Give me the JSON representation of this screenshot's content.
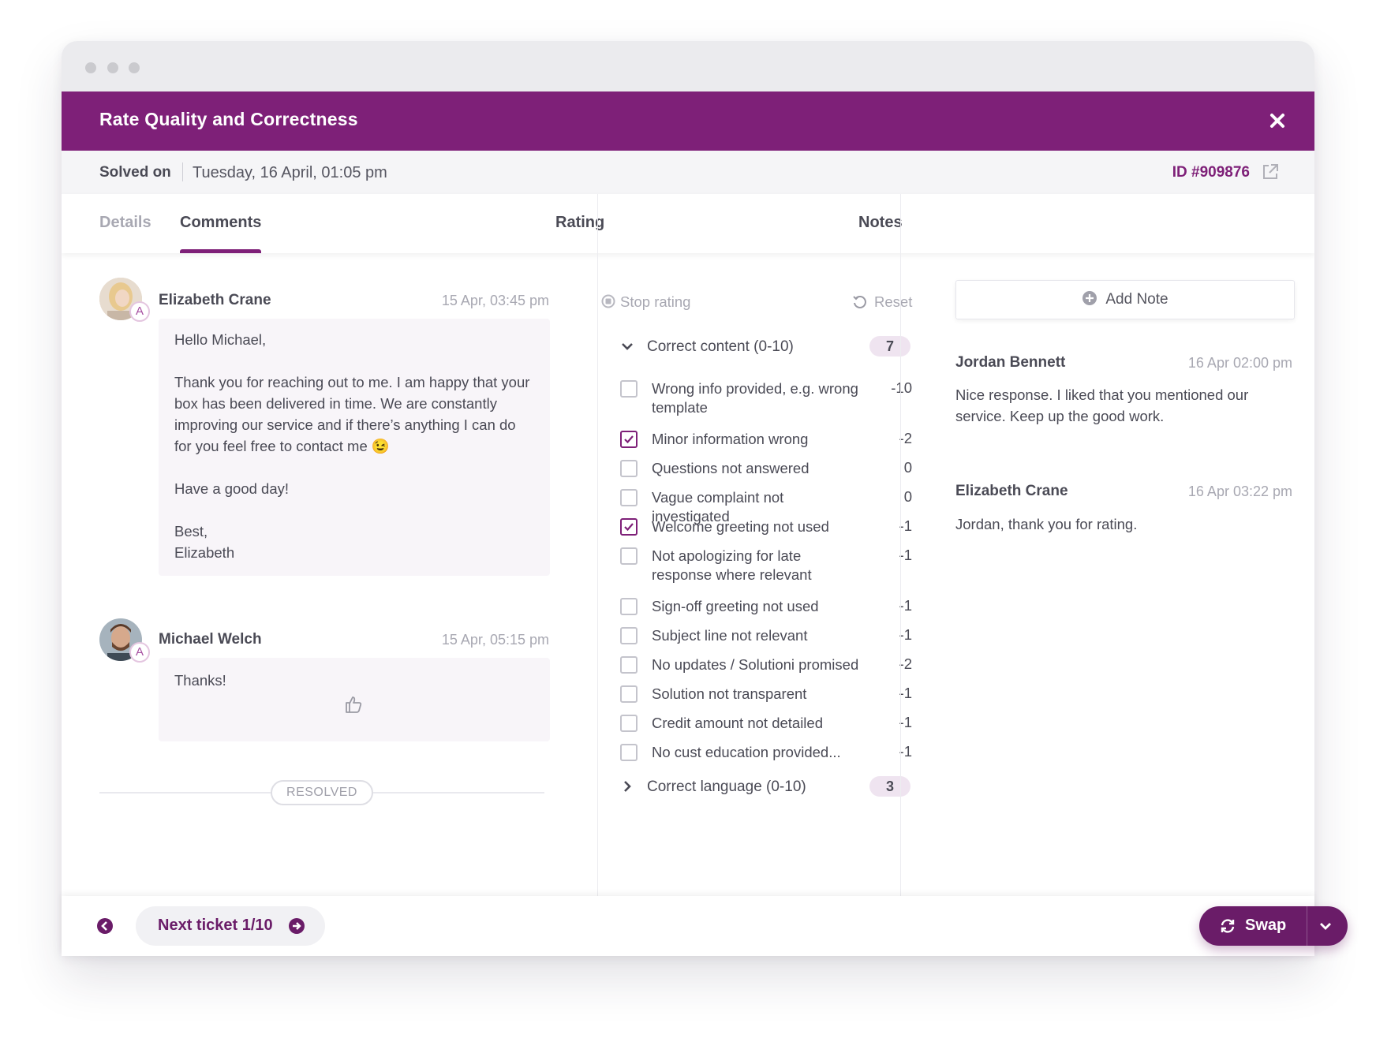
{
  "window": {
    "title": "Rate Quality and Correctness"
  },
  "info": {
    "solved_label": "Solved on",
    "solved_value": "Tuesday, 16 April, 01:05 pm",
    "ticket_id": "ID #909876"
  },
  "tabs": [
    {
      "label": "Details"
    },
    {
      "label": "Comments"
    }
  ],
  "columns": {
    "rating": "Rating",
    "notes": "Notes"
  },
  "comments": [
    {
      "author": "Elizabeth Crane",
      "time": "15 Apr, 03:45 pm",
      "badge": "A",
      "paragraphs": [
        "Hello Michael,",
        "Thank you for reaching out to me. I am happy that your box has been delivered in time. We are constantly improving our service and if there’s anything I can do for you feel free to contact me 😉",
        "Have a good day!",
        "Best,\nElizabeth"
      ]
    },
    {
      "author": "Michael Welch",
      "time": "15 Apr, 05:15 pm",
      "badge": "A",
      "paragraphs": [
        "Thanks!"
      ]
    }
  ],
  "resolved_label": "RESOLVED",
  "rating": {
    "stop_label": "Stop rating",
    "reset_label": "Reset",
    "sections": [
      {
        "label": "Correct content (0-10)",
        "score": "7",
        "expanded": true,
        "items": [
          {
            "label": "Wrong info provided, e.g. wrong template",
            "value": "-10",
            "checked": false
          },
          {
            "label": "Minor information wrong",
            "value": "-2",
            "checked": true
          },
          {
            "label": "Questions not answered",
            "value": "0",
            "checked": false
          },
          {
            "label": "Vague complaint not investigated",
            "value": "0",
            "checked": false
          },
          {
            "label": "Welcome greeting not used",
            "value": "-1",
            "checked": true
          },
          {
            "label": "Not apologizing for late response where relevant",
            "value": "-1",
            "checked": false
          },
          {
            "label": "Sign-off greeting not used",
            "value": "-1",
            "checked": false
          },
          {
            "label": "Subject line not relevant",
            "value": "-1",
            "checked": false
          },
          {
            "label": "No updates / Solutioni promised",
            "value": "-2",
            "checked": false
          },
          {
            "label": "Solution not transparent",
            "value": "-1",
            "checked": false
          },
          {
            "label": "Credit amount not detailed",
            "value": "-1",
            "checked": false
          },
          {
            "label": "No cust education provided...",
            "value": "-1",
            "checked": false
          }
        ]
      },
      {
        "label": "Correct language (0-10)",
        "score": "3",
        "expanded": false,
        "items": []
      }
    ]
  },
  "notes": {
    "add_label": "Add Note",
    "items": [
      {
        "author": "Jordan Bennett",
        "time": "16 Apr 02:00 pm",
        "text": "Nice response. I liked that you mentioned our service. Keep up the good work."
      },
      {
        "author": "Elizabeth Crane",
        "time": "16 Apr 03:22 pm",
        "text": "Jordan, thank you for rating."
      }
    ]
  },
  "footer": {
    "next_label": "Next ticket 1/10",
    "swap_label": "Swap"
  },
  "colors": {
    "brand": "#7e2078",
    "brand_dark": "#6a1c68",
    "score_pill": "#efe4f0"
  },
  "icons": [
    "close-icon",
    "external-link-icon",
    "stop-icon",
    "reset-icon",
    "chevron-down-icon",
    "chevron-right-icon",
    "check-icon",
    "thumbs-up-icon",
    "plus-circle-icon",
    "arrow-left-circle-icon",
    "arrow-right-circle-icon",
    "swap-icon"
  ]
}
